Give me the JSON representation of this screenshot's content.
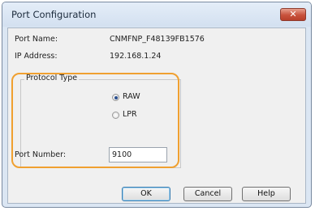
{
  "dialog": {
    "title": "Port Configuration",
    "close_label": "✕"
  },
  "fields": {
    "port_name_label": "Port Name:",
    "port_name_value": "CNMFNP_F48139FB1576",
    "ip_address_label": "IP Address:",
    "ip_address_value": "192.168.1.24"
  },
  "protocol": {
    "group_label": "Protocol Type",
    "options": [
      {
        "label": "RAW",
        "selected": true
      },
      {
        "label": "LPR",
        "selected": false
      }
    ]
  },
  "port_number": {
    "label": "Port Number:",
    "value": "9100"
  },
  "buttons": {
    "ok": "OK",
    "cancel": "Cancel",
    "help": "Help"
  },
  "colors": {
    "highlight": "#f0a030",
    "close_button": "#c8523c"
  }
}
